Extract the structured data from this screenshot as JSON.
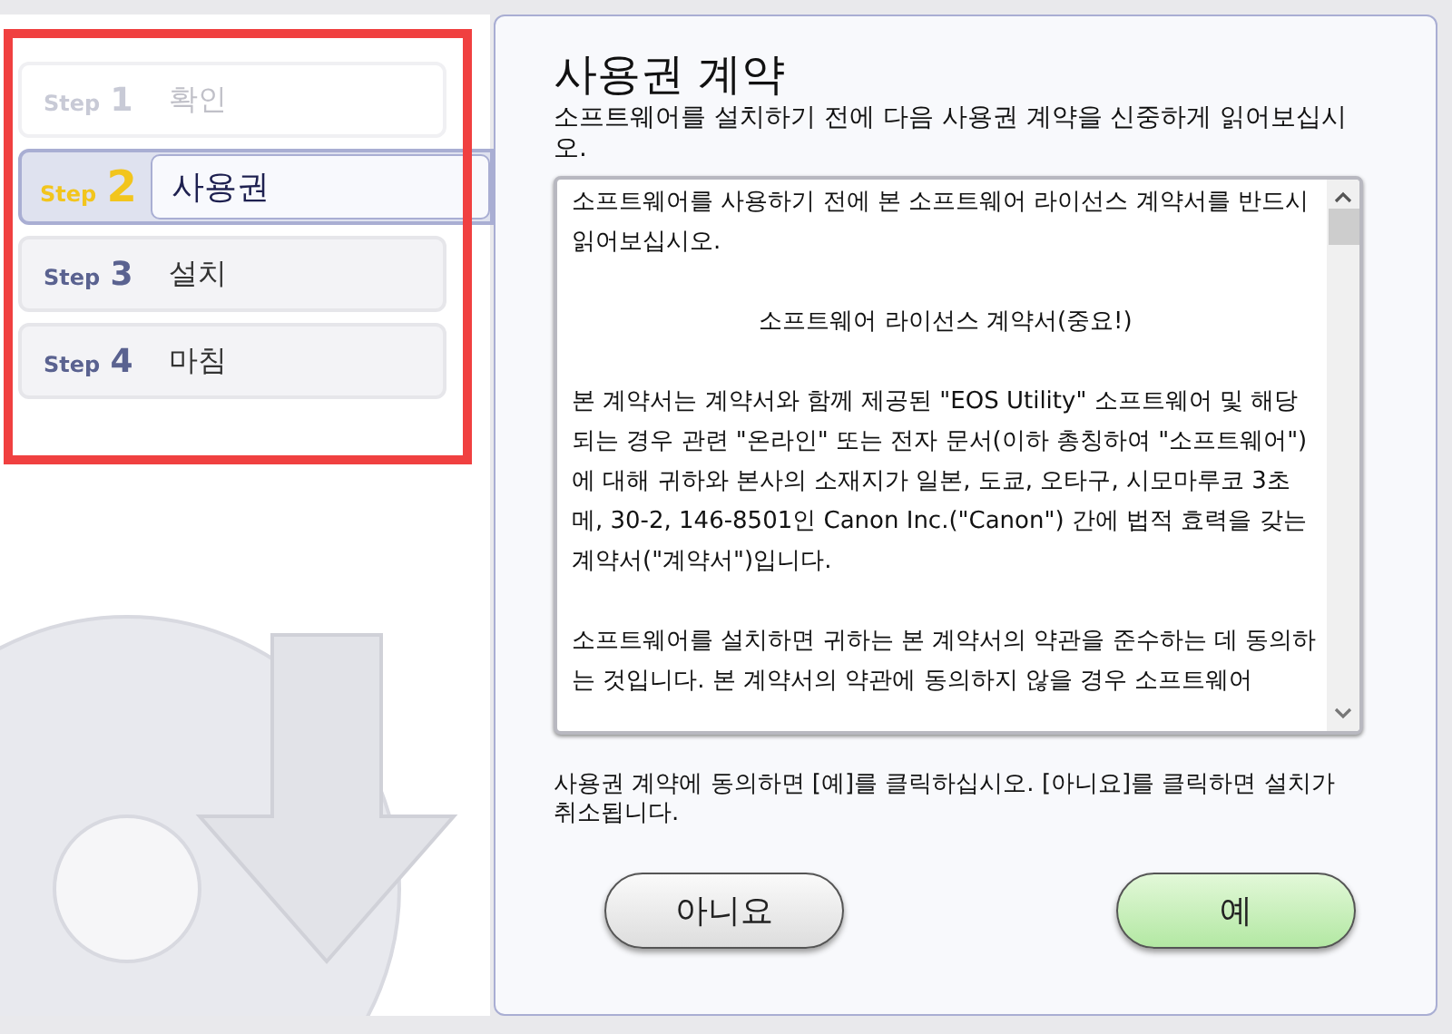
{
  "steps": [
    {
      "label": "Step",
      "number": "1",
      "name": "확인",
      "selected": false,
      "completed": true
    },
    {
      "label": "Step",
      "number": "2",
      "name": "사용권",
      "selected": true,
      "completed": false
    },
    {
      "label": "Step",
      "number": "3",
      "name": "설치",
      "selected": false,
      "completed": false
    },
    {
      "label": "Step",
      "number": "4",
      "name": "마침",
      "selected": false,
      "completed": false
    }
  ],
  "title": "사용권 계약",
  "instruction": "소프트웨어를 설치하기 전에 다음 사용권 계약을 신중하게 읽어보십시오.",
  "license": [
    {
      "kind": "para",
      "text": "소프트웨어를 사용하기 전에 본 소프트웨어 라이선스 계약서를 반드시 읽어보십시오."
    },
    {
      "kind": "heading",
      "text": "소프트웨어 라이선스 계약서(중요!)"
    },
    {
      "kind": "para",
      "text": "본 계약서는 계약서와 함께 제공된 \"EOS Utility\" 소프트웨어 및 해당되는 경우 관련 \"온라인\" 또는 전자 문서(이하 총칭하여 \"소프트웨어\")에 대해 귀하와 본사의 소재지가 일본, 도쿄, 오타구, 시모마루코 3초메, 30-2, 146-8501인 Canon Inc.(\"Canon\") 간에 법적 효력을 갖는 계약서(\"계약서\")입니다."
    },
    {
      "kind": "para",
      "text": "소프트웨어를 설치하면 귀하는 본 계약서의 약관을 준수하는 데 동의하는 것입니다.  본 계약서의 약관에 동의하지 않을 경우 소프트웨어"
    }
  ],
  "note": "사용권 계약에 동의하면 [예]를 클릭하십시오. [아니요]를 클릭하면 설치가 취소됩니다.",
  "buttons": [
    {
      "label": "아니요",
      "kind": "secondary"
    },
    {
      "label": "예",
      "kind": "primary"
    }
  ]
}
